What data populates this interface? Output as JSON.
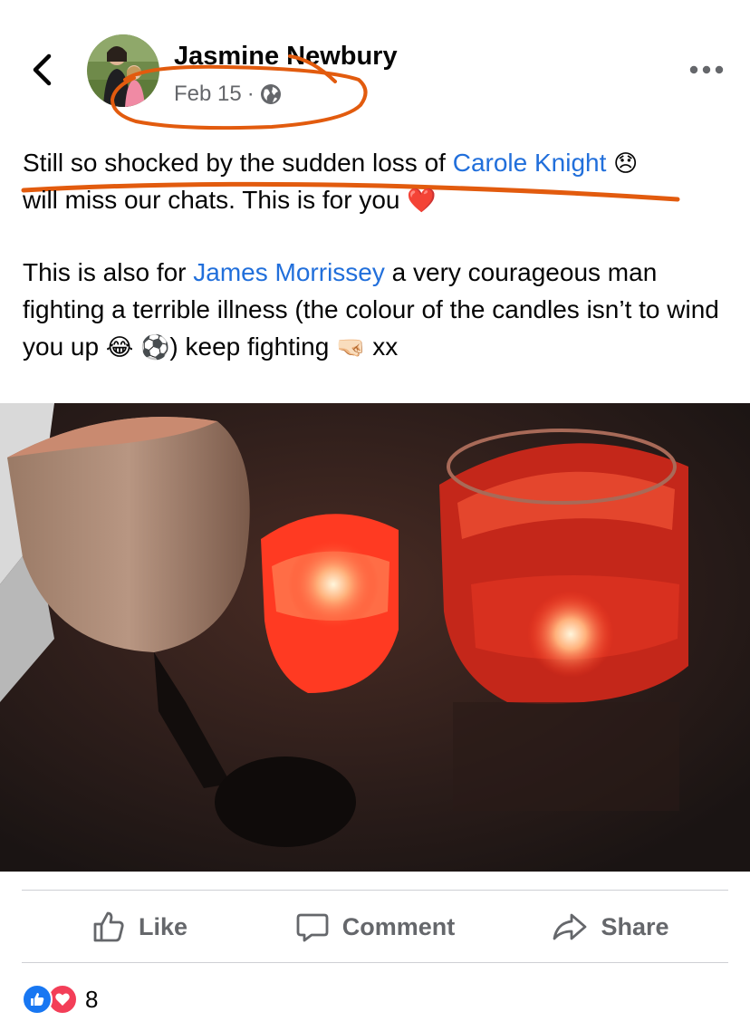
{
  "post": {
    "author": "Jasmine Newbury",
    "date": "Feb 15",
    "separator": "·",
    "privacy_icon": "globe-icon",
    "paragraph1": {
      "part1": "Still so shocked by the sudden loss of ",
      "mention": "Carole Knight",
      "emoji": "😞",
      "part2": " will miss our chats. This is for you ",
      "emoji2": "❤️"
    },
    "paragraph2": {
      "part1": "This is also for ",
      "mention": "James Morrissey",
      "part2": " a very courageous man fighting a terrible illness (the colour of the candles isn’t to wind you up ",
      "emoji1": "😂",
      "emoji2": "⚽",
      "part3": ") keep fighting ",
      "emoji3": "🤜🏻",
      "part4": " xx"
    },
    "photo_alt": "Photo of a wine glass and two lit red candles in glass jars"
  },
  "actions": {
    "like": "Like",
    "comment": "Comment",
    "share": "Share"
  },
  "reactions": {
    "count": "8",
    "types": [
      "like-icon",
      "love-icon"
    ]
  },
  "colors": {
    "link": "#216fdb",
    "secondary_text": "#65676b",
    "annotation": "#e25b0e",
    "like_blue": "#1877f2",
    "love_red": "#f33e58"
  }
}
